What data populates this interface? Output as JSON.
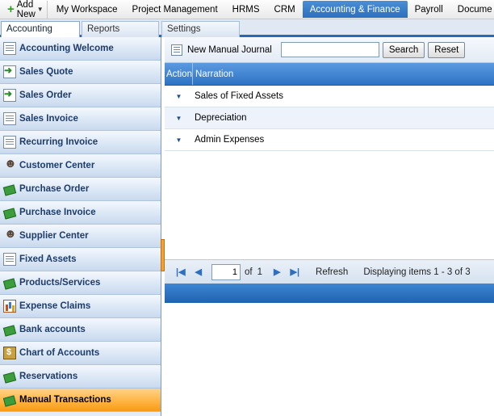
{
  "topbar": {
    "add_new": "Add New",
    "menus": [
      "My Workspace",
      "Project Management",
      "HRMS",
      "CRM",
      "Accounting & Finance",
      "Payroll",
      "Docume"
    ],
    "active_menu_index": 4
  },
  "tabs": [
    {
      "label": "Accounting",
      "active": true
    },
    {
      "label": "Reports",
      "active": false
    },
    {
      "label": "Settings",
      "active": false
    }
  ],
  "sidebar": {
    "items": [
      {
        "label": "Accounting Welcome",
        "icon": "document-icon"
      },
      {
        "label": "Sales Quote",
        "icon": "sales-quote-icon"
      },
      {
        "label": "Sales Order",
        "icon": "sales-order-icon"
      },
      {
        "label": "Sales Invoice",
        "icon": "invoice-icon"
      },
      {
        "label": "Recurring Invoice",
        "icon": "recurring-invoice-icon"
      },
      {
        "label": "Customer Center",
        "icon": "customer-center-icon"
      },
      {
        "label": "Purchase Order",
        "icon": "purchase-order-icon"
      },
      {
        "label": "Purchase Invoice",
        "icon": "purchase-invoice-icon"
      },
      {
        "label": "Supplier Center",
        "icon": "supplier-center-icon"
      },
      {
        "label": "Fixed Assets",
        "icon": "fixed-assets-icon"
      },
      {
        "label": "Products/Services",
        "icon": "products-services-icon"
      },
      {
        "label": "Expense Claims",
        "icon": "expense-claims-icon"
      },
      {
        "label": "Bank accounts",
        "icon": "bank-accounts-icon"
      },
      {
        "label": "Chart of Accounts",
        "icon": "chart-of-accounts-icon"
      },
      {
        "label": "Reservations",
        "icon": "reservations-icon"
      },
      {
        "label": "Manual Transactions",
        "icon": "manual-transactions-icon"
      }
    ],
    "active_index": 15
  },
  "toolbar": {
    "new_label": "New Manual Journal",
    "search_value": "",
    "search_button": "Search",
    "reset_button": "Reset"
  },
  "grid": {
    "columns": [
      "Action",
      "Narration"
    ],
    "rows": [
      {
        "narration": "Sales of Fixed Assets"
      },
      {
        "narration": "Depreciation"
      },
      {
        "narration": "Admin Expenses"
      }
    ]
  },
  "pager": {
    "page": "1",
    "of_label": "of",
    "total_pages": "1",
    "refresh_label": "Refresh",
    "display_text": "Displaying items 1 - 3 of 3"
  },
  "colors": {
    "accent_blue": "#2d73c4",
    "active_orange": "#ffb545",
    "sidebar_text": "#1d3c6b"
  }
}
